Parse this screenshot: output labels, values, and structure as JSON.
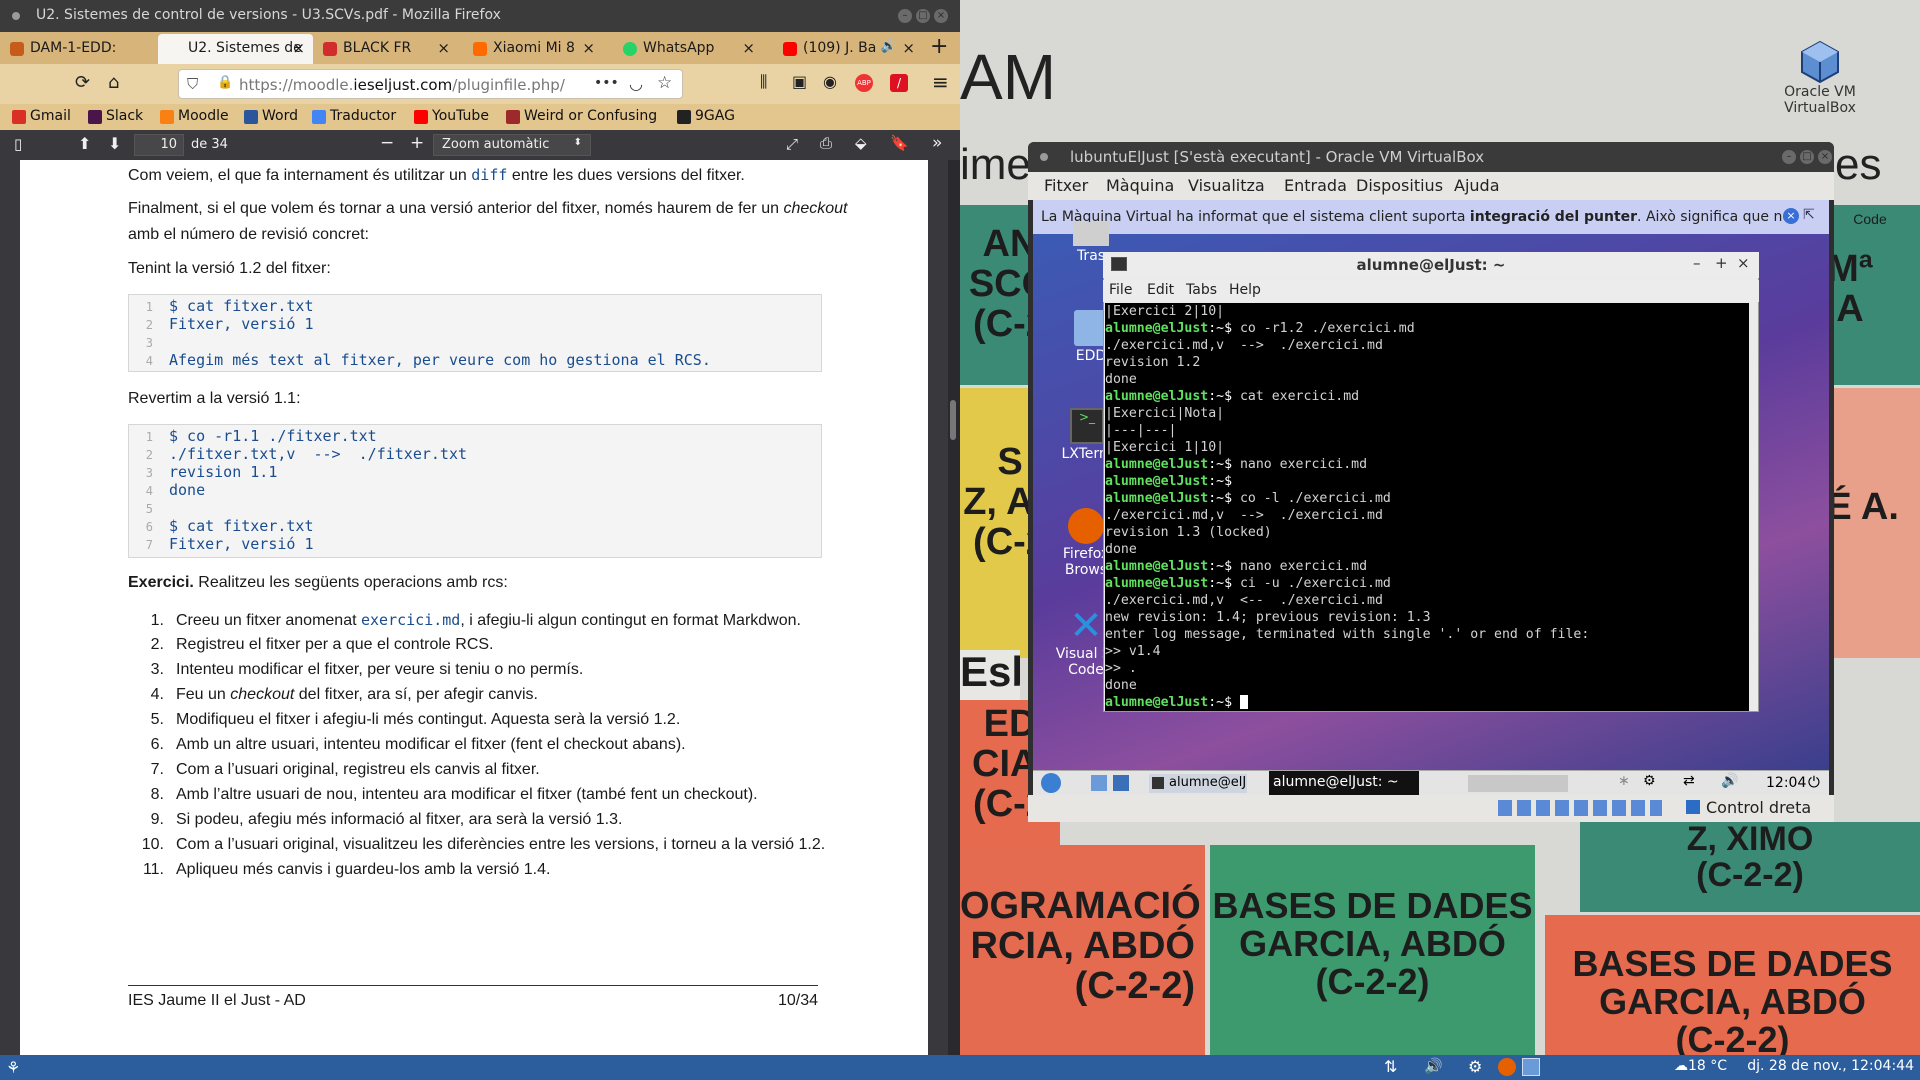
{
  "firefox": {
    "window_title": "U2. Sistemes de control de versions - U3.SCVs.pdf - Mozilla Firefox",
    "tabs": [
      {
        "label": "DAM-1-EDD:",
        "active": false,
        "color": "#c75b1a"
      },
      {
        "label": "U2. Sistemes de",
        "active": true,
        "color": "#e0402a"
      },
      {
        "label": "BLACK FR",
        "active": false,
        "color": "#d22d2d"
      },
      {
        "label": "Xiaomi Mi 8",
        "active": false,
        "color": "#ff6a00"
      },
      {
        "label": "WhatsApp",
        "active": false,
        "color": "#25d366"
      },
      {
        "label": "(109) J. Ba",
        "active": false,
        "color": "#ff0000"
      }
    ],
    "new_tab": "+",
    "url_prefix": "https://moodle.",
    "url_domain": "ieseljust.com",
    "url_path": "/pluginfile.php/",
    "url_more": "•••",
    "bookmarks": [
      {
        "label": "Gmail",
        "color": "#d93025"
      },
      {
        "label": "Slack",
        "color": "#4a154b"
      },
      {
        "label": "Moodle",
        "color": "#f98012"
      },
      {
        "label": "Word",
        "color": "#2b579a"
      },
      {
        "label": "Traductor",
        "color": "#4285f4"
      },
      {
        "label": "YouTube",
        "color": "#ff0000"
      },
      {
        "label": "Weird or Confusing",
        "color": "#9c2a2a"
      },
      {
        "label": "9GAG",
        "color": "#222222"
      }
    ],
    "pdf_toolbar": {
      "page_number": "10",
      "page_total": "de 34",
      "zoom_out": "−",
      "zoom_in": "+",
      "zoom_value": "Zoom automàtic"
    }
  },
  "pdf": {
    "intro_before": "Com veiem, el que fa internament és utilitzar un",
    "intro_code": "diff",
    "intro_after": "entre les dues versions del fitxer.",
    "finalment_before": "Finalment, si el que volem és tornar a una versió anterior del fitxer, només haurem de fer un",
    "finalment_em": "checkout",
    "finalment_line2": "amb el número de revisió concret:",
    "tenint": "Tenint la versió 1.2 del fitxer:",
    "code1": [
      {
        "n": "1",
        "text": "$ cat fitxer.txt"
      },
      {
        "n": "2",
        "text": "Fitxer, versió 1"
      },
      {
        "n": "3",
        "text": ""
      },
      {
        "n": "4",
        "text": "Afegim més text al fitxer, per veure com ho gestiona el RCS."
      }
    ],
    "revertim": "Revertim a la versió 1.1:",
    "code2": [
      {
        "n": "1",
        "text": "$ co -r1.1 ./fitxer.txt"
      },
      {
        "n": "2",
        "text": "./fitxer.txt,v  -->  ./fitxer.txt"
      },
      {
        "n": "3",
        "text": "revision 1.1"
      },
      {
        "n": "4",
        "text": "done"
      },
      {
        "n": "5",
        "text": ""
      },
      {
        "n": "6",
        "text": "$ cat fitxer.txt"
      },
      {
        "n": "7",
        "text": "Fitxer, versió 1"
      }
    ],
    "exercici_bold": "Exercici.",
    "exercici_text": "Realitzeu les següents operacions amb rcs:",
    "item1_before": "Creeu un fitxer anomenat",
    "item1_code": "exercici.md",
    "item1_after": ", i afegiu-li algun contingut en format Markdwon.",
    "item4_before": "Feu un",
    "item4_em": "checkout",
    "item4_after": "del fitxer, ara sí, per afegir canvis.",
    "items": [
      {
        "n": "1.",
        "text": ""
      },
      {
        "n": "2.",
        "text": "Registreu el fitxer per a que el controle RCS."
      },
      {
        "n": "3.",
        "text": "Intenteu modificar el fitxer, per veure si teniu o no permís."
      },
      {
        "n": "4.",
        "text": ""
      },
      {
        "n": "5.",
        "text": "Modifiqueu el fitxer i afegiu-li més contingut. Aquesta serà la versió 1.2."
      },
      {
        "n": "6.",
        "text": "Amb un altre usuari, intenteu modificar el fitxer (fent el checkout abans)."
      },
      {
        "n": "7.",
        "text": "Com a l’usuari original, registreu els canvis al fitxer."
      },
      {
        "n": "8.",
        "text": "Amb l’altre usuari de nou, intenteu ara modificar el fitxer (també fent un checkout)."
      },
      {
        "n": "9.",
        "text": "Si podeu, afegiu més informació al fitxer, ara serà la versió 1.3."
      },
      {
        "n": "10.",
        "text": "Com a l’usuari original, visualitzeu les diferències entre les versions, i torneu a la versió 1.2."
      },
      {
        "n": "11.",
        "text": "Apliqueu més canvis i guardeu-los amb la versió 1.4."
      }
    ],
    "footer_left": "IES Jaume II el Just - AD",
    "footer_right": "10/34"
  },
  "desktop": {
    "vbox_icon_label_1": "Oracle VM",
    "vbox_icon_label_2": "VirtualBox",
    "wallpaper_texts": {
      "am": "AM",
      "ime": "ime",
      "es": "es",
      "code": "Code",
      "an": "AN",
      "sco": "SCO",
      "c2": "(C-2",
      "ma": "Mª",
      "a": "A",
      "s": "S",
      "zal": "Z, AL",
      "c2b": "(C-2",
      "seA": "SÉ A.",
      "esb": "Esb",
      "ed": "ED",
      "cia": "CIA,",
      "c2c": "(C-2",
      "ximo": "Z, XIMO",
      "c22a": "(C-2-2)",
      "gramacio": "OGRAMACIÓ",
      "rcia": "RCIA, ABDÓ",
      "c22b": "(C-2-2)",
      "bases1": "BASES DE DADES",
      "garcia1": "GARCIA, ABDÓ",
      "c22c": "(C-2-2)",
      "bases2": "BASES DE DADES",
      "garcia2": "GARCIA, ABDÓ",
      "c22d": "(C-2-2)"
    }
  },
  "virtualbox": {
    "title": "lubuntuElJust [S'està executant] - Oracle VM VirtualBox",
    "menu": [
      "Fitxer",
      "Màquina",
      "Visualitza",
      "Entrada",
      "Dispositius",
      "Ajuda"
    ],
    "notice_before": "La Màquina Virtual ha informat que el sistema client suporta",
    "notice_bold": "integració del punter",
    "notice_after": ". Això significa que no",
    "status_host_key": "Control dreta",
    "guest_icons": [
      {
        "label": "Tras"
      },
      {
        "label": "EDD"
      },
      {
        "label": "LXTerm"
      },
      {
        "label1": "Firefox",
        "label2": "Brows"
      },
      {
        "label1": "Visual St",
        "label2": "Code"
      }
    ],
    "guest_panel": {
      "task1": "alumne@elJu",
      "task2": "alumne@elJust: ~",
      "clock": "12:04"
    }
  },
  "terminal": {
    "title": "alumne@elJust: ~",
    "menu": [
      "File",
      "Edit",
      "Tabs",
      "Help"
    ],
    "prompt": "alumne@elJust",
    "lines": [
      {
        "type": "out",
        "text": "|Exercici 2|10|"
      },
      {
        "type": "cmd",
        "text": "co -r1.2 ./exercici.md"
      },
      {
        "type": "out",
        "text": "./exercici.md,v  -->  ./exercici.md"
      },
      {
        "type": "out",
        "text": "revision 1.2"
      },
      {
        "type": "out",
        "text": "done"
      },
      {
        "type": "cmd",
        "text": "cat exercici.md"
      },
      {
        "type": "out",
        "text": "|Exercici|Nota|"
      },
      {
        "type": "out",
        "text": "|---|---|"
      },
      {
        "type": "out",
        "text": "|Exercici 1|10|"
      },
      {
        "type": "cmd",
        "text": "nano exercici.md"
      },
      {
        "type": "cmd",
        "text": ""
      },
      {
        "type": "cmd",
        "text": "co -l ./exercici.md"
      },
      {
        "type": "out",
        "text": "./exercici.md,v  -->  ./exercici.md"
      },
      {
        "type": "out",
        "text": "revision 1.3 (locked)"
      },
      {
        "type": "out",
        "text": "done"
      },
      {
        "type": "cmd",
        "text": "nano exercici.md"
      },
      {
        "type": "cmd",
        "text": "ci -u ./exercici.md"
      },
      {
        "type": "out",
        "text": "./exercici.md,v  <--  ./exercici.md"
      },
      {
        "type": "out",
        "text": "new revision: 1.4; previous revision: 1.3"
      },
      {
        "type": "out",
        "text": "enter log message, terminated with single '.' or end of file:"
      },
      {
        "type": "out",
        "text": ">> v1.4"
      },
      {
        "type": "out",
        "text": ">> ."
      },
      {
        "type": "out",
        "text": "done"
      },
      {
        "type": "cmd",
        "text": ""
      }
    ]
  },
  "taskbar": {
    "weather": "18 °C",
    "datetime": "dj. 28 de nov., 12:04:44"
  }
}
